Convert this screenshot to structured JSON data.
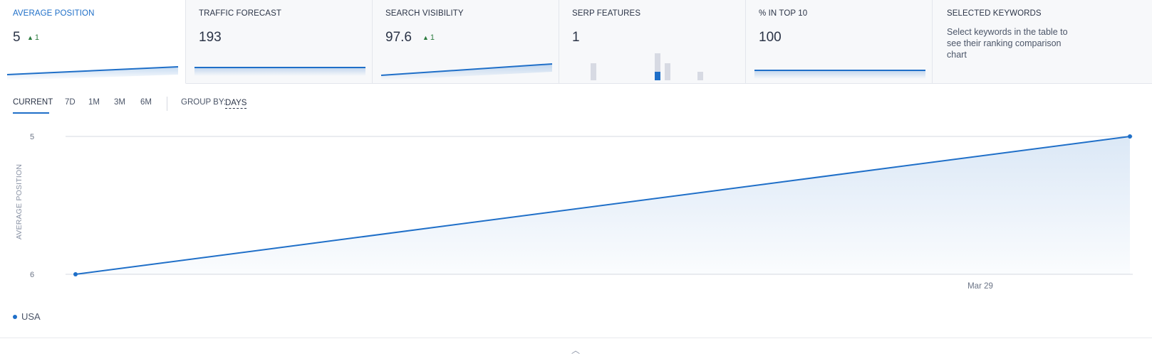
{
  "cards": [
    {
      "title": "AVERAGE POSITION",
      "value": "5",
      "delta": "1"
    },
    {
      "title": "TRAFFIC FORECAST",
      "value": "193"
    },
    {
      "title": "SEARCH VISIBILITY",
      "value": "97.6",
      "delta": "1"
    },
    {
      "title": "SERP FEATURES",
      "value": "1"
    },
    {
      "title": "% IN TOP 10",
      "value": "100"
    },
    {
      "title": "SELECTED KEYWORDS",
      "description": "Select keywords in the table to see their ranking comparison chart"
    }
  ],
  "toolbar": {
    "tabs": [
      "CURRENT",
      "7D",
      "1M",
      "3M",
      "6M"
    ],
    "group_by_label": "GROUP BY:",
    "group_by_value": "DAYS"
  },
  "chart": {
    "y_axis_label": "AVERAGE POSITION",
    "legend": "USA",
    "collapse_icon": "chevron-up-icon"
  },
  "colors": {
    "accent": "#1f6fc8",
    "positive": "#2a7a3d",
    "card_bg": "#f7f8fa",
    "bar_gray": "#d7dae3"
  },
  "chart_data": {
    "type": "area",
    "title": "",
    "xlabel": "",
    "ylabel": "AVERAGE POSITION",
    "x_tick_labels": [
      "Mar 29"
    ],
    "y_tick_labels": [
      "5",
      "6"
    ],
    "ylim": [
      6,
      5
    ],
    "y_inverted": true,
    "grid": true,
    "legend_position": "bottom-left",
    "series": [
      {
        "name": "USA",
        "x": [
          "start",
          "end"
        ],
        "values": [
          6,
          5
        ]
      }
    ]
  }
}
